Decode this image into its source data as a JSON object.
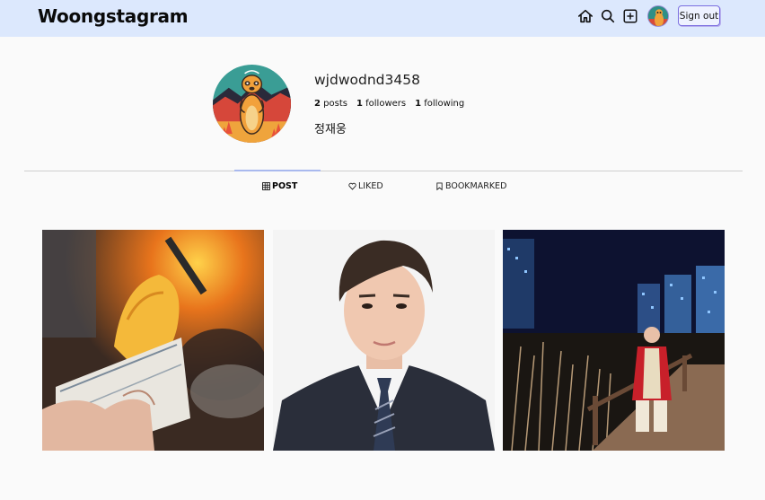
{
  "header": {
    "logo": "Woongstagram",
    "nav_icons": [
      "home-icon",
      "search-icon",
      "add-post-icon",
      "avatar"
    ],
    "signout_label": "Sign out",
    "background": "#dce8fd"
  },
  "profile": {
    "username": "wjdwodnd3458",
    "posts_count": "2",
    "posts_label": "posts",
    "followers_count": "1",
    "followers_label": "followers",
    "following_count": "1",
    "following_label": "following",
    "full_name": "정재웅"
  },
  "tabs": [
    {
      "label": "POST",
      "icon": "grid-icon",
      "active": true
    },
    {
      "label": "LIKED",
      "icon": "heart-icon",
      "active": false
    },
    {
      "label": "BOOKMARKED",
      "icon": "bookmark-icon",
      "active": false
    }
  ],
  "posts": [
    {
      "subject": "roasted sweet potato in paper cup by a campfire"
    },
    {
      "subject": "portrait of young man in dark suit and striped tie"
    },
    {
      "subject": "man in red jacket on wooden boardwalk at night with city lights"
    }
  ]
}
